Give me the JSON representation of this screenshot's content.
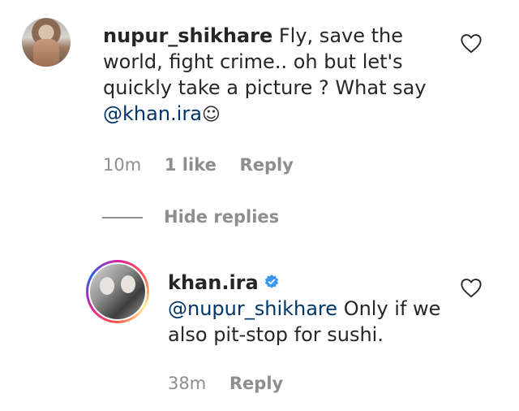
{
  "comment": {
    "username": "nupur_shikhare",
    "text_before_mention": "Fly, save the world, fight crime.. oh but let's quickly take a picture ? What say",
    "mention": "@khan.ira",
    "emoji": "☺",
    "time": "10m",
    "likes": "1 like",
    "reply_label": "Reply"
  },
  "hide_replies_label": "Hide replies",
  "reply": {
    "username": "khan.ira",
    "mention": "@nupur_shikhare",
    "text_after_mention": "Only if we also pit-stop for sushi.",
    "time": "38m",
    "reply_label": "Reply"
  },
  "colors": {
    "text": "#262626",
    "muted": "#8e8e8e",
    "mention": "#003569",
    "verified": "#3897f0"
  },
  "icons": {
    "like": "heart-outline-icon",
    "verified": "verified-badge-icon"
  }
}
